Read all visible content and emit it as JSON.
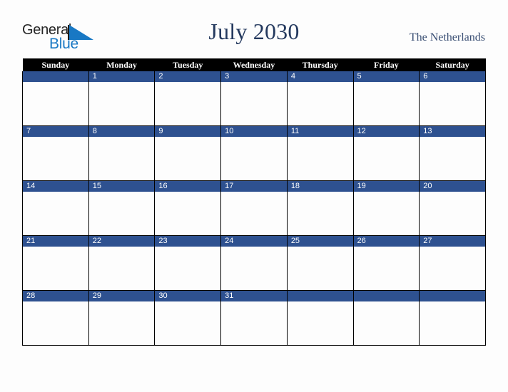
{
  "logo": {
    "word_one": "General",
    "word_two": "Blue",
    "triangle_icon": "triangle-right-icon",
    "blue_hex": "#1878c4",
    "dark_hex": "#262626"
  },
  "header": {
    "title": "July 2030",
    "country": "The Netherlands",
    "title_color": "#24395e",
    "country_color": "#3a4f74"
  },
  "calendar": {
    "header_bg": "#000000",
    "header_text_color": "#ffffff",
    "day_band_color": "#2e5190",
    "day_number_color": "#ffffff",
    "cell_bg": "#fdfdfd",
    "border_color": "#000000",
    "weekdays": [
      "Sunday",
      "Monday",
      "Tuesday",
      "Wednesday",
      "Thursday",
      "Friday",
      "Saturday"
    ],
    "weeks": [
      [
        {
          "day": ""
        },
        {
          "day": "1"
        },
        {
          "day": "2"
        },
        {
          "day": "3"
        },
        {
          "day": "4"
        },
        {
          "day": "5"
        },
        {
          "day": "6"
        }
      ],
      [
        {
          "day": "7"
        },
        {
          "day": "8"
        },
        {
          "day": "9"
        },
        {
          "day": "10"
        },
        {
          "day": "11"
        },
        {
          "day": "12"
        },
        {
          "day": "13"
        }
      ],
      [
        {
          "day": "14"
        },
        {
          "day": "15"
        },
        {
          "day": "16"
        },
        {
          "day": "17"
        },
        {
          "day": "18"
        },
        {
          "day": "19"
        },
        {
          "day": "20"
        }
      ],
      [
        {
          "day": "21"
        },
        {
          "day": "22"
        },
        {
          "day": "23"
        },
        {
          "day": "24"
        },
        {
          "day": "25"
        },
        {
          "day": "26"
        },
        {
          "day": "27"
        }
      ],
      [
        {
          "day": "28"
        },
        {
          "day": "29"
        },
        {
          "day": "30"
        },
        {
          "day": "31"
        },
        {
          "day": ""
        },
        {
          "day": ""
        },
        {
          "day": ""
        }
      ]
    ]
  }
}
